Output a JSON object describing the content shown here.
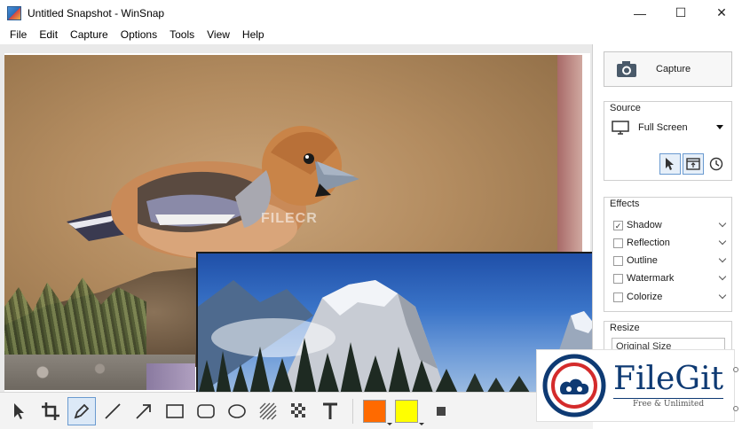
{
  "window": {
    "title": "Untitled Snapshot - WinSnap",
    "minimize_glyph": "—",
    "maximize_glyph": "☐",
    "close_glyph": "✕"
  },
  "menu": [
    "File",
    "Edit",
    "Capture",
    "Options",
    "Tools",
    "View",
    "Help"
  ],
  "canvas": {
    "watermark_text": "FILECR"
  },
  "toolbar": {
    "tools": [
      {
        "name": "select-tool",
        "icon": "cursor-icon"
      },
      {
        "name": "crop-tool",
        "icon": "crop-icon"
      },
      {
        "name": "pen-tool",
        "icon": "pen-icon",
        "active": true
      },
      {
        "name": "line-tool",
        "icon": "line-icon"
      },
      {
        "name": "arrow-tool",
        "icon": "arrow-icon"
      },
      {
        "name": "rectangle-tool",
        "icon": "rectangle-icon"
      },
      {
        "name": "rounded-rectangle-tool",
        "icon": "rounded-rectangle-icon"
      },
      {
        "name": "ellipse-tool",
        "icon": "ellipse-icon"
      },
      {
        "name": "hatch-tool",
        "icon": "hatch-icon"
      },
      {
        "name": "pixelate-tool",
        "icon": "checker-icon"
      },
      {
        "name": "text-tool",
        "icon": "text-icon"
      }
    ],
    "colors": {
      "primary": "#ff6a00",
      "secondary": "#ffff00"
    }
  },
  "panel": {
    "capture_label": "Capture",
    "source": {
      "title": "Source",
      "value": "Full Screen"
    },
    "effects": {
      "title": "Effects",
      "items": [
        {
          "label": "Shadow",
          "checked": true
        },
        {
          "label": "Reflection",
          "checked": false
        },
        {
          "label": "Outline",
          "checked": false
        },
        {
          "label": "Watermark",
          "checked": false
        },
        {
          "label": "Colorize",
          "checked": false
        }
      ]
    },
    "resize": {
      "title": "Resize",
      "value": "Original Size"
    }
  },
  "overlay": {
    "name": "FileGit",
    "tagline": "Free & Unlimited"
  }
}
